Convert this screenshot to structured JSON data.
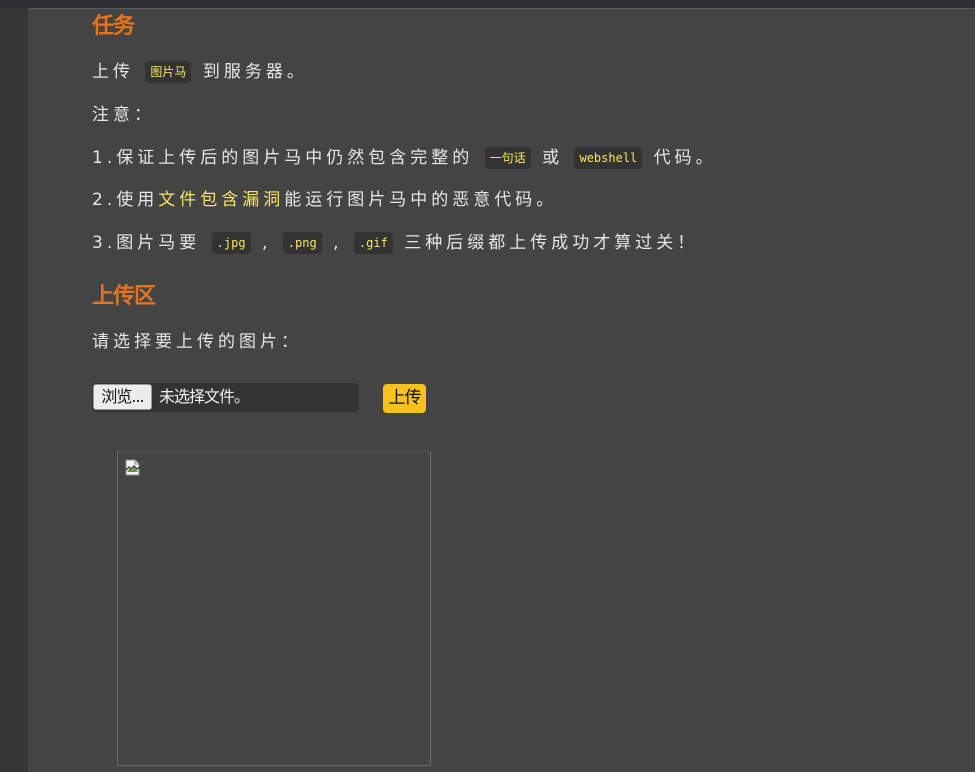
{
  "task": {
    "heading": "任务",
    "line1": {
      "pre": "上传",
      "code": "图片马",
      "post": "到服务器。"
    },
    "note_label": "注意：",
    "item1": {
      "pre": "1.保证上传后的图片马中仍然包含完整的",
      "code1": "一句话",
      "mid": "或",
      "code2": "webshell",
      "post": "代码。"
    },
    "item2": {
      "pre": "2.使用",
      "highlight": "文件包含漏洞",
      "post": "能运行图片马中的恶意代码。"
    },
    "item3": {
      "pre": "3.图片马要",
      "code1": ".jpg",
      "sep1": ",",
      "code2": ".png",
      "sep2": ",",
      "code3": ".gif",
      "post": "三种后缀都上传成功才算过关！"
    }
  },
  "upload": {
    "heading": "上传区",
    "prompt": "请选择要上传的图片：",
    "browse_label": "浏览...",
    "file_status": "未选择文件。",
    "submit_label": "上传"
  },
  "preview": {
    "icon": "broken-image-icon"
  },
  "colors": {
    "background": "#444444",
    "heading": "#e8731f",
    "code_text": "#f5e663",
    "upload_button": "#f7c21d"
  }
}
